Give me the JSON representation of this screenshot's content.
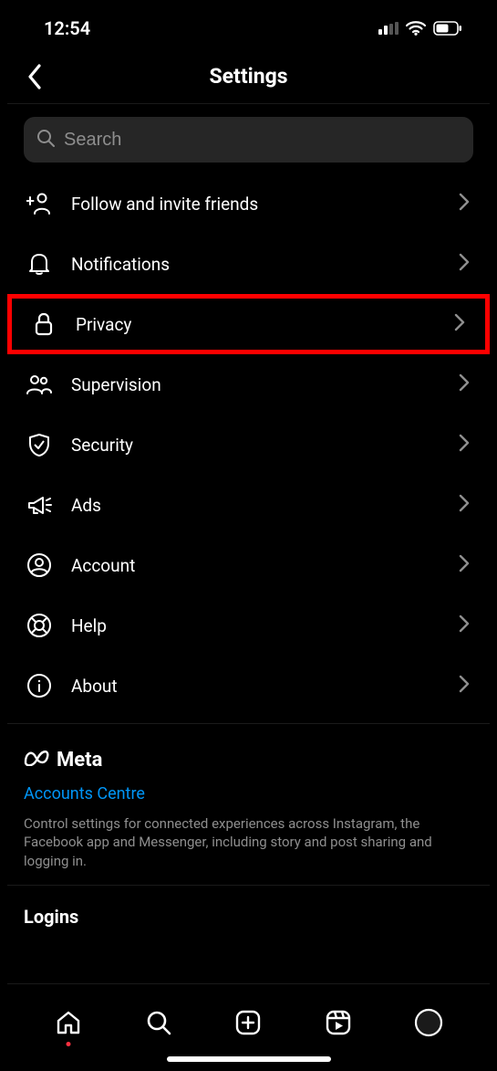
{
  "status": {
    "time": "12:54"
  },
  "header": {
    "title": "Settings"
  },
  "search": {
    "placeholder": "Search"
  },
  "items": [
    {
      "id": "follow-invite",
      "label": "Follow and invite friends",
      "highlight": false
    },
    {
      "id": "notifications",
      "label": "Notifications",
      "highlight": false
    },
    {
      "id": "privacy",
      "label": "Privacy",
      "highlight": true
    },
    {
      "id": "supervision",
      "label": "Supervision",
      "highlight": false
    },
    {
      "id": "security",
      "label": "Security",
      "highlight": false
    },
    {
      "id": "ads",
      "label": "Ads",
      "highlight": false
    },
    {
      "id": "account",
      "label": "Account",
      "highlight": false
    },
    {
      "id": "help",
      "label": "Help",
      "highlight": false
    },
    {
      "id": "about",
      "label": "About",
      "highlight": false
    }
  ],
  "meta": {
    "brand": "Meta",
    "accounts_link": "Accounts Centre",
    "description": "Control settings for connected experiences across Instagram, the Facebook app and Messenger, including story and post sharing and logging in."
  },
  "logins": {
    "heading": "Logins"
  },
  "colors": {
    "accent": "#0095f6",
    "highlight": "#ff0000"
  }
}
